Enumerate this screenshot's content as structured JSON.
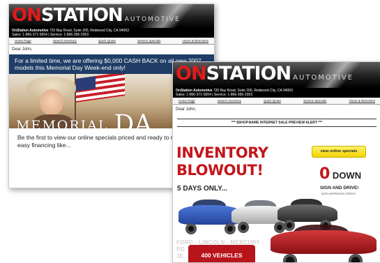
{
  "brand": {
    "on": "ON",
    "station": "STATION",
    "auto": "AUTOMOTIVE"
  },
  "address": {
    "line1_name": "OnStation Automotive",
    "line1_rest": " 720 Bay Road, Suite 200, Redwood City, CA 94063",
    "line2": "Sales: 1-866-371-5654 | Service: 1-866-395-2353"
  },
  "nav": [
    "Home Page",
    "Search Inventory",
    "Quick Quote",
    "Service Specials",
    "Hours & Directions"
  ],
  "greeting": "Dear John,",
  "email1": {
    "promo": "For a limited time, we are offering $0,000 CASH BACK on all new 2007 models this Memorial Day Week-end only!",
    "memorial_small": "MEMORIAL ",
    "memorial_big": "DA",
    "body": "Be the first to view our online specials priced and ready to move with easy financing like..."
  },
  "email2": {
    "alert": "*** $SHOP.NAME INTERNET SALE PREVIEW ALERT ***",
    "headline_1": "INVENTORY",
    "headline_2": "BLOWOUT!",
    "days": "5 DAYS ONLY...",
    "view_button": "view online specials",
    "zero": "0",
    "down": " DOWN",
    "sign": "SIGN AND DRIVE!",
    "approved": "WITH APPROVED CREDIT",
    "brands_line1": "FORD - LINCOLN - MERCURY -",
    "brands_line2": "PO",
    "brands_line3": "JE",
    "badge": "400 VEHICLES"
  },
  "colors": {
    "accent_red": "#c4161c",
    "promo_blue": "#1f3d66",
    "button_yellow": "#f2d200"
  }
}
